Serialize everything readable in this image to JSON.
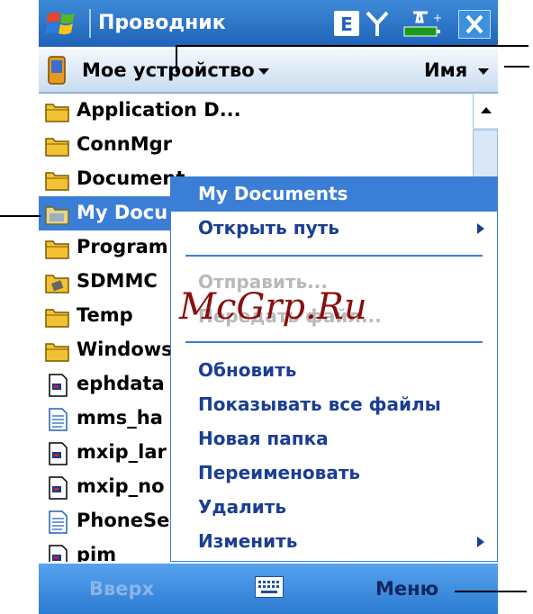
{
  "titlebar": {
    "title": "Проводник",
    "keyboard_indicator": "E",
    "icons": [
      "windows-start-icon",
      "signal-icon",
      "battery-icon",
      "close-icon"
    ]
  },
  "pathbar": {
    "location": "Мое устройство",
    "sort": "Имя"
  },
  "files": [
    {
      "name": "Application D...",
      "icon": "folder-icon"
    },
    {
      "name": "ConnMgr",
      "icon": "folder-icon"
    },
    {
      "name": "Document",
      "icon": "folder-icon"
    },
    {
      "name": "My Docu",
      "icon": "my-documents-icon",
      "selected": true
    },
    {
      "name": "Program",
      "icon": "folder-icon"
    },
    {
      "name": "SDMMC",
      "icon": "storage-card-icon"
    },
    {
      "name": "Temp",
      "icon": "folder-icon"
    },
    {
      "name": "Windows",
      "icon": "folder-icon"
    },
    {
      "name": "ephdata",
      "icon": "file-icon"
    },
    {
      "name": "mms_ha",
      "icon": "document-icon"
    },
    {
      "name": "mxip_lar",
      "icon": "file-icon"
    },
    {
      "name": "mxip_no",
      "icon": "file-icon"
    },
    {
      "name": "PhoneSe",
      "icon": "document-icon"
    },
    {
      "name": "pim",
      "icon": "file-icon"
    }
  ],
  "context_menu": {
    "header": "My Documents",
    "open_path": "Открыть путь",
    "send": "Отправить...",
    "transfer": "Передать файл...",
    "refresh": "Обновить",
    "show_all": "Показывать все файлы",
    "new_folder": "Новая папка",
    "rename": "Переименовать",
    "delete": "Удалить",
    "edit": "Изменить"
  },
  "watermark": "McGrp.Ru",
  "softkeys": {
    "left": "Вверх",
    "right": "Меню"
  },
  "colors": {
    "accent": "#3b7ed6",
    "menu_text": "#1b3e94",
    "disabled": "#b9b9b9"
  }
}
